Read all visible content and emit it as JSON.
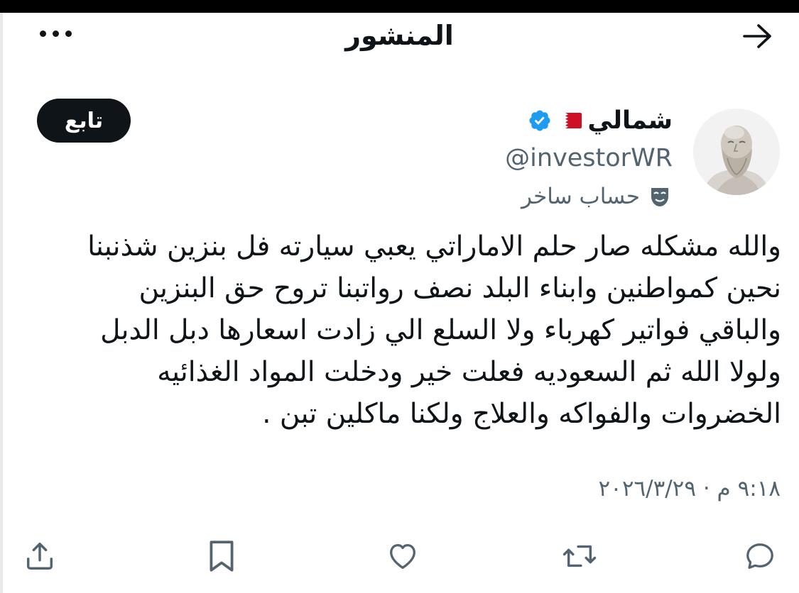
{
  "header": {
    "title": "المنشور",
    "more_icon": "more-horizontal-icon",
    "back_icon": "arrow-right-icon"
  },
  "author": {
    "display_name": "شمالي",
    "handle": "@investorWR",
    "flag_icon": "bahrain-flag-icon",
    "verified_icon": "verified-badge-icon",
    "parody_label": "حساب ساخر",
    "parody_icon": "theater-mask-icon",
    "verified_color": "#1d9bf0"
  },
  "follow_button": {
    "label": "تابع"
  },
  "tweet": {
    "lines": [
      "والله مشكله صار حلم الاماراتي يعبي سيارته فل بنزين شذنبنا",
      "نحين كمواطنين وابناء البلد نصف رواتبنا تروح حق البنزين",
      "والباقي فواتير كهرباء ولا السلع الي زادت اسعارها دبل الدبل",
      "ولولا الله ثم السعوديه فعلت خير ودخلت المواد الغذائيه",
      "الخضروات والفواكه والعلاج ولكنا ماكلين تبن ."
    ],
    "timestamp": "٩:١٨ م · ٢٠٢٦/٣/٢٩"
  },
  "actions": [
    {
      "icon": "reply-icon"
    },
    {
      "icon": "retweet-icon"
    },
    {
      "icon": "like-icon"
    },
    {
      "icon": "bookmark-icon"
    },
    {
      "icon": "share-icon"
    }
  ]
}
